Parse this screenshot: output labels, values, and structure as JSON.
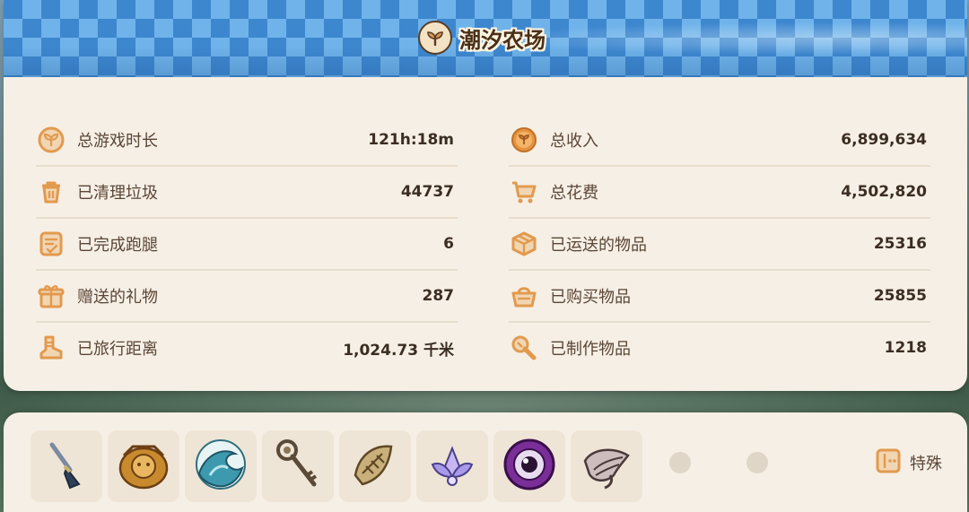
{
  "header": {
    "title": "潮汐农场",
    "emblem_icon": "sprout-icon"
  },
  "stats": {
    "left": [
      {
        "icon": "sprout-badge-icon",
        "label": "总游戏时长",
        "value": "121h:18m"
      },
      {
        "icon": "trash-icon",
        "label": "已清理垃圾",
        "value": "44737"
      },
      {
        "icon": "checklist-icon",
        "label": "已完成跑腿",
        "value": "6"
      },
      {
        "icon": "gift-icon",
        "label": "赠送的礼物",
        "value": "287"
      },
      {
        "icon": "boot-icon",
        "label": "已旅行距离",
        "value": "1,024.73 千米"
      }
    ],
    "right": [
      {
        "icon": "coin-icon",
        "label": "总收入",
        "value": "6,899,634"
      },
      {
        "icon": "cart-icon",
        "label": "总花费",
        "value": "4,502,820"
      },
      {
        "icon": "box-icon",
        "label": "已运送的物品",
        "value": "25316"
      },
      {
        "icon": "basket-icon",
        "label": "已购买物品",
        "value": "25855"
      },
      {
        "icon": "hammer-icon",
        "label": "已制作物品",
        "value": "1218"
      }
    ]
  },
  "inventory": {
    "items": [
      {
        "icon": "brush-icon"
      },
      {
        "icon": "golden-relic-icon"
      },
      {
        "icon": "wave-orb-icon"
      },
      {
        "icon": "old-key-icon"
      },
      {
        "icon": "fossil-icon"
      },
      {
        "icon": "crystal-lotus-icon"
      },
      {
        "icon": "purple-eye-icon"
      },
      {
        "icon": "seashell-icon"
      }
    ],
    "empty_slots": 2,
    "special_label": "特殊",
    "special_icon": "special-tab-icon"
  },
  "colors": {
    "accent": "#e29a4e",
    "text": "#5b4636",
    "panel": "#f6efe5",
    "banner": "#3d87cf"
  }
}
